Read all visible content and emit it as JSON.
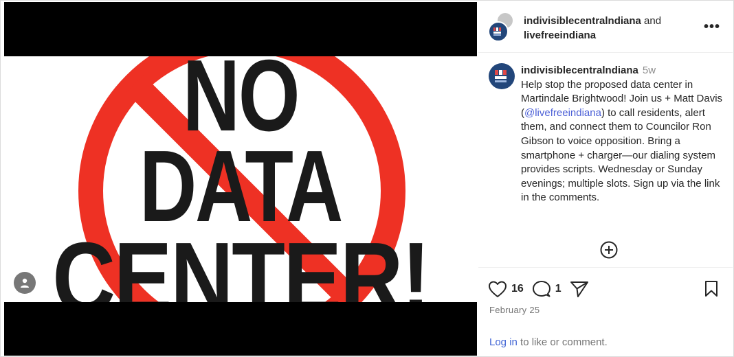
{
  "post": {
    "image": {
      "lines": [
        "NO",
        "DATA",
        "CENTER!"
      ],
      "sign_color": "#ee3124",
      "text_color": "#1a1a1a"
    }
  },
  "header": {
    "user1": "indivisiblecentralndiana",
    "joiner": " and",
    "user2": "livefreeindiana",
    "more_label": "•••"
  },
  "caption": {
    "username": "indivisiblecentralndiana",
    "time": "5w",
    "text_before": "Help stop the proposed data center in Martindale Brightwood! Join us + Matt Davis (",
    "mention": "@livefreeindiana",
    "text_after": ") to call residents, alert them, and connect them to Councilor Ron Gibson to voice opposition. Bring a smartphone + charger—our dialing system provides scripts. Wednesday or Sunday evenings; multiple slots. Sign up via the link in the comments."
  },
  "actions": {
    "likes": "16",
    "comments": "1",
    "date": "February 25",
    "login_link": "Log in",
    "login_suffix": " to like or comment."
  },
  "icons": {
    "heart": "heart-icon",
    "comment": "comment-icon",
    "share": "share-icon",
    "bookmark": "bookmark-icon",
    "add": "add-comment-icon",
    "user": "user-tag-icon"
  }
}
